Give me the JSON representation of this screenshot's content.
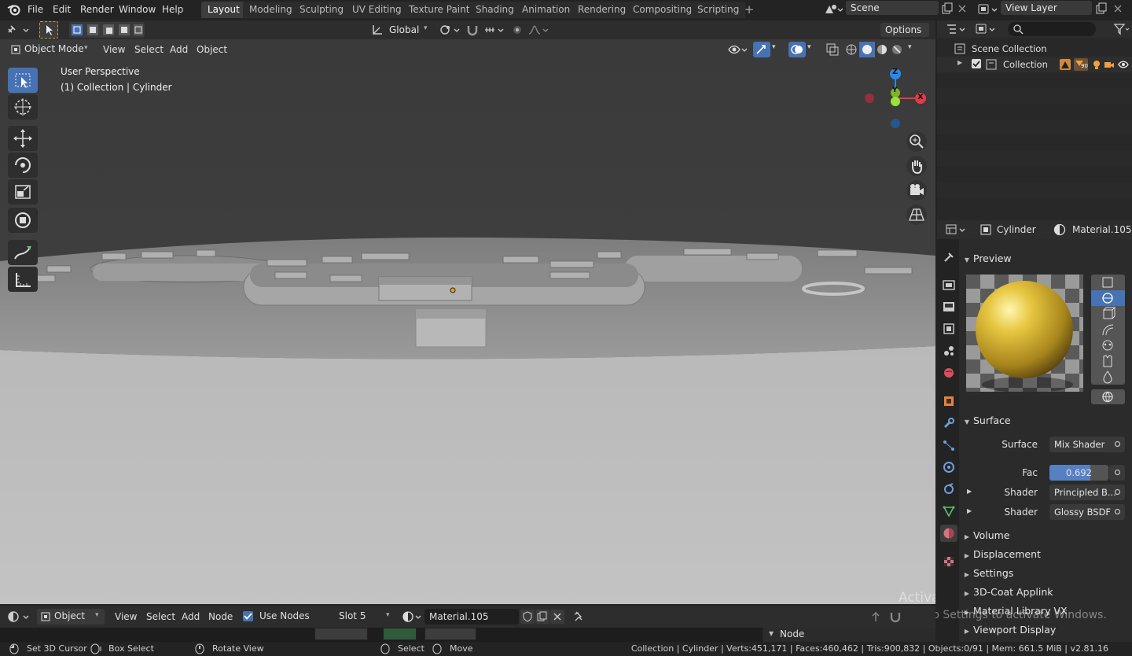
{
  "topbar": {
    "menus": [
      "File",
      "Edit",
      "Render",
      "Window",
      "Help"
    ],
    "workspaces": [
      "Layout",
      "Modeling",
      "Sculpting",
      "UV Editing",
      "Texture Paint",
      "Shading",
      "Animation",
      "Rendering",
      "Compositing",
      "Scripting"
    ],
    "active_workspace": "Layout",
    "add_tab": "+",
    "scene_name": "Scene",
    "view_layer": "View Layer"
  },
  "viewport_header": {
    "transform_orientation": "Global",
    "options_label": "Options",
    "mode": "Object Mode",
    "menus": [
      "View",
      "Select",
      "Add",
      "Object"
    ]
  },
  "viewport": {
    "overlay_line1": "User Perspective",
    "overlay_line2": "(1) Collection | Cylinder",
    "gizmo_axes": {
      "z": "Z",
      "y": "Y",
      "x": "X"
    },
    "watermark_title": "Activate Windows",
    "watermark_sub": "Go to Settings to activate Windows."
  },
  "outliner": {
    "root": "Scene Collection",
    "collection": "Collection",
    "filter_count": "90"
  },
  "properties": {
    "object_name": "Cylinder",
    "material_name": "Material.105",
    "sections": {
      "preview": "Preview",
      "surface": "Surface",
      "volume": "Volume",
      "displacement": "Displacement",
      "settings": "Settings",
      "coat": "3D-Coat Applink",
      "matlib": "Material Library VX",
      "viewport_display": "Viewport Display"
    },
    "surface_label": "Surface",
    "surface_value": "Mix Shader",
    "fac_label": "Fac",
    "fac_value": "0.692",
    "fac_fraction": 0.692,
    "shader1_label": "Shader",
    "shader1_value": "Principled B...",
    "shader2_label": "Shader",
    "shader2_value": "Glossy BSDF"
  },
  "node_header": {
    "mode": "Object",
    "menus": [
      "View",
      "Select",
      "Add",
      "Node"
    ],
    "use_nodes": "Use Nodes",
    "slot": "Slot 5",
    "material": "Material.105",
    "side_panel": "Node"
  },
  "statusbar": {
    "left": [
      "Set 3D Cursor",
      "Box Select",
      "Rotate View",
      "Select",
      "Move"
    ],
    "right": "Collection | Cylinder | Verts:451,171 | Faces:460,462 | Tris:900,832 | Objects:0/91 | Mem: 661.5 MiB | v2.81.16"
  },
  "colors": {
    "accent": "#4772b3",
    "axis_x": "#e33a4b",
    "axis_y": "#7fb32b",
    "axis_z": "#2a88e6",
    "material_yellow": "#d4b33a"
  }
}
